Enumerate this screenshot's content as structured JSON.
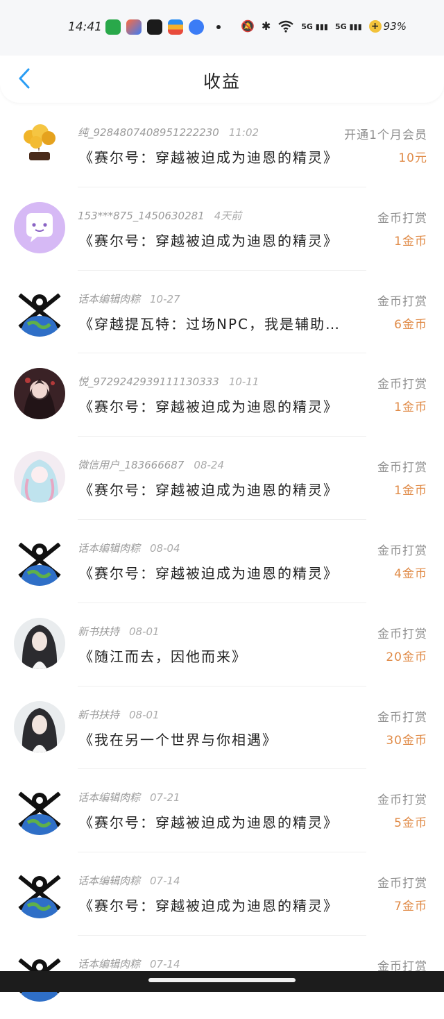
{
  "status": {
    "time": "14:41",
    "network1": "5G",
    "network2": "5G",
    "battery": "93%",
    "colors": {
      "app1": "#29a84a",
      "app2": "#ff6a3d",
      "app3": "#1b1b1b",
      "app4": "#2a8cf0",
      "app5": "#3b7cf6"
    }
  },
  "header": {
    "title": "收益",
    "back_icon": "chevron-left-icon",
    "accent": "#2a9df4"
  },
  "items": [
    {
      "user": "纯_9284807408951222230",
      "date": "11:02",
      "book": "《赛尔号：穿越被迫成为迪恩的精灵》",
      "type": "开通1个月会员",
      "amount": "10元",
      "avatar": "money-tree"
    },
    {
      "user": "153***875_1450630281",
      "date": "4天前",
      "book": "《赛尔号：穿越被迫成为迪恩的精灵》",
      "type": "金币打赏",
      "amount": "1金币",
      "avatar": "chat-bubble"
    },
    {
      "user": "话本编辑肉粽",
      "date": "10-27",
      "book": "《穿越提瓦特：过场NPC，我是辅助？》",
      "type": "金币打赏",
      "amount": "6金币",
      "avatar": "earth-skull"
    },
    {
      "user": "悦_9729242939111130333",
      "date": "10-11",
      "book": "《赛尔号：穿越被迫成为迪恩的精灵》",
      "type": "金币打赏",
      "amount": "1金币",
      "avatar": "dark-girl"
    },
    {
      "user": "微信用户_183666687",
      "date": "08-24",
      "book": "《赛尔号：穿越被迫成为迪恩的精灵》",
      "type": "金币打赏",
      "amount": "1金币",
      "avatar": "pastel-girl"
    },
    {
      "user": "话本编辑肉粽",
      "date": "08-04",
      "book": "《赛尔号：穿越被迫成为迪恩的精灵》",
      "type": "金币打赏",
      "amount": "4金币",
      "avatar": "earth-skull"
    },
    {
      "user": "新书扶持",
      "date": "08-01",
      "book": "《随江而去，因他而来》",
      "type": "金币打赏",
      "amount": "20金币",
      "avatar": "long-hair-man"
    },
    {
      "user": "新书扶持",
      "date": "08-01",
      "book": "《我在另一个世界与你相遇》",
      "type": "金币打赏",
      "amount": "30金币",
      "avatar": "long-hair-man"
    },
    {
      "user": "话本编辑肉粽",
      "date": "07-21",
      "book": "《赛尔号：穿越被迫成为迪恩的精灵》",
      "type": "金币打赏",
      "amount": "5金币",
      "avatar": "earth-skull"
    },
    {
      "user": "话本编辑肉粽",
      "date": "07-14",
      "book": "《赛尔号：穿越被迫成为迪恩的精灵》",
      "type": "金币打赏",
      "amount": "7金币",
      "avatar": "earth-skull"
    },
    {
      "user": "话本编辑肉粽",
      "date": "07-14",
      "book": "",
      "type": "金币打赏",
      "amount": "",
      "avatar": "earth-skull"
    }
  ]
}
